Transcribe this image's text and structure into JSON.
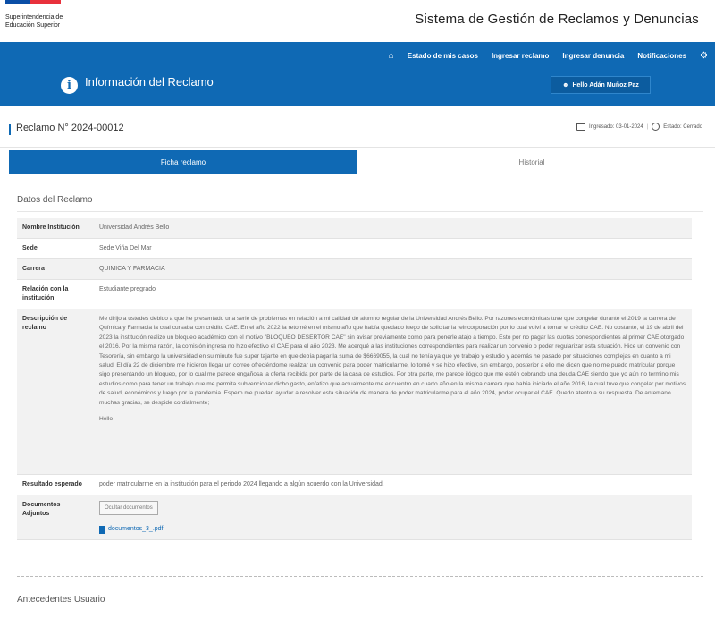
{
  "header": {
    "org": "Superintendencia de Educación Superior",
    "system_name": "Sistema de Gestión de Reclamos y Denuncias"
  },
  "nav": {
    "home_icon": "home-icon",
    "items": [
      "Estado de mis casos",
      "Ingresar reclamo",
      "Ingresar denuncia",
      "Notificaciones"
    ],
    "settings_icon": "gear-icon"
  },
  "subheader": {
    "title": "Información del Reclamo",
    "user_label": "Hello Adán Muñoz Paz"
  },
  "case": {
    "title": "Reclamo N° 2024-00012",
    "ingresado": "Ingresado: 03-01-2024",
    "estado": "Estado: Cerrado"
  },
  "tabs": {
    "active": "Ficha reclamo",
    "other": "Historial"
  },
  "section": {
    "title": "Datos del Reclamo",
    "next_title": "Antecedentes Usuario"
  },
  "fields": {
    "institucion_label": "Nombre Institución",
    "institucion_value": "Universidad Andrés Bello",
    "sede_label": "Sede",
    "sede_value": "Sede Viña Del Mar",
    "carrera_label": "Carrera",
    "carrera_value": "QUIMICA Y FARMACIA",
    "relacion_label": "Relación con la institución",
    "relacion_value": "Estudiante pregrado",
    "descripcion_label": "Descripción de reclamo",
    "descripcion_value": "Me dirijo a ustedes debido a que he presentado una serie de problemas en relación a mi calidad de alumno regular de la Universidad Andrés Bello. Por razones económicas tuve que congelar durante el 2019 la carrera de Química y Farmacia la cual cursaba con crédito CAE. En el año 2022 la retomé en el mismo año que había quedado luego de solicitar la reincorporación por lo cual volví a tomar el crédito CAE. No obstante, el 19 de abril del 2023 la institución realizó un bloqueo académico con el motivo \"BLOQUEO DESERTOR CAE\" sin avisar previamente como para ponerle atajo a tiempo. Esto por no pagar las cuotas correspondientes al primer CAE otorgado el 2016. Por la misma razón, la comisión ingresa no hizo efectivo el CAE para el año 2023. Me acerqué a las instituciones correspondientes para realizar un convenio o poder regularizar esta situación. Hice un convenio con Tesorería, sin embargo la universidad en su minuto fue super tajante en que debía pagar la suma de $6669055, la cual no tenía ya que yo trabajo y estudio y además he pasado por situaciones complejas en cuanto a mi salud. El día 22 de diciembre me hicieron llegar un correo ofreciéndome realizar un convenio para poder matricularme, lo tomé y se hizo efectivo, sin embargo, posterior a ello me dicen que no me puedo matricular porque sigo presentando un bloqueo, por lo cual me parece engañosa la oferta recibida por parte de la casa de estudios. Por otra parte, me parece ilógico que me estén cobrando una deuda CAE siendo que yo aún no termino mis estudios como para tener un trabajo que me permita subvencionar dicho gasto, enfatizo que actualmente me encuentro en cuarto año en la misma carrera que había iniciado el año 2016, la cual tuve que congelar por motivos de salud, económicos y luego por la pandemia. Espero me puedan ayudar a resolver esta situación de manera de poder matricularme para el año 2024, poder ocupar el CAE. Quedo atento a su respuesta. De antemano muchas gracias, se despide cordialmente;",
    "descripcion_bye": "Hello",
    "resultado_label": "Resultado esperado",
    "resultado_value": "poder matricularme en la institución para el periodo 2024 llegando a algún acuerdo con la Universidad.",
    "documentos_label": "Documentos Adjuntos",
    "documentos_button": "Ocultar documentos",
    "documento_file": "documentos_3_.pdf"
  }
}
